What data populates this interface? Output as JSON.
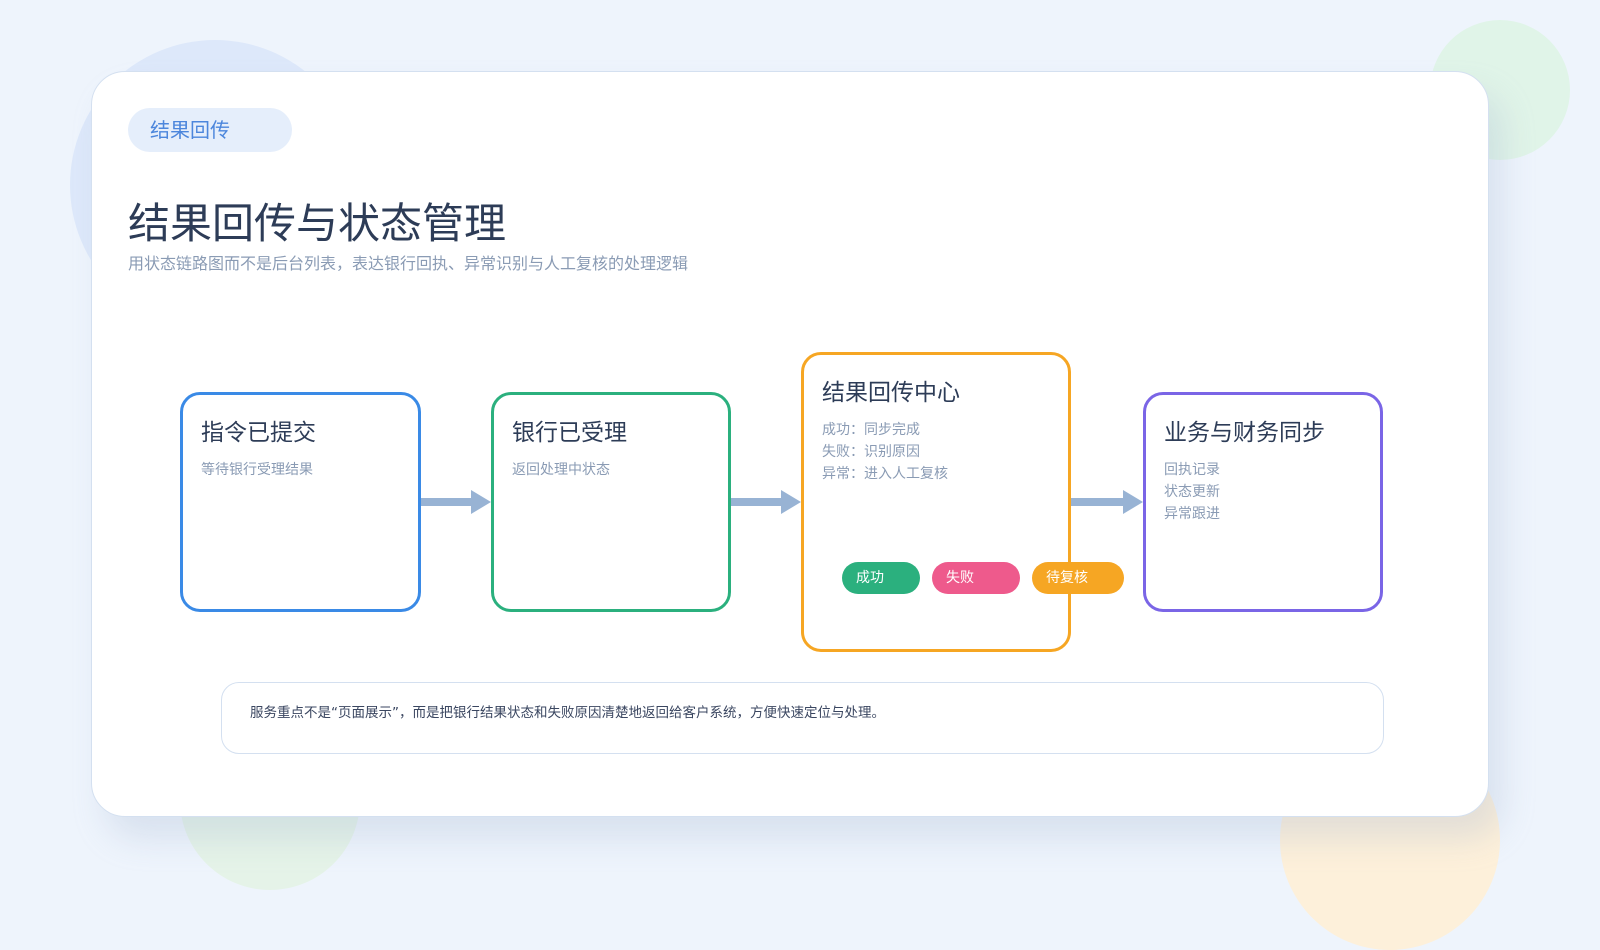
{
  "tag": "结果回传",
  "title": "结果回传与状态管理",
  "subtitle": "用状态链路图而不是后台列表，表达银行回执、异常识别与人工复核的处理逻辑",
  "nodes": [
    {
      "title": "指令已提交",
      "lines": [
        "等待银行受理结果"
      ],
      "color": "#3a8ae6"
    },
    {
      "title": "银行已受理",
      "lines": [
        "返回处理中状态"
      ],
      "color": "#2bb07e"
    },
    {
      "title": "结果回传中心",
      "lines": [
        "成功：同步完成",
        "失败：识别原因",
        "异常：进入人工复核"
      ],
      "color": "#f6a623"
    },
    {
      "title": "业务与财务同步",
      "lines": [
        "回执记录",
        "状态更新",
        "异常跟进"
      ],
      "color": "#7a65e6"
    }
  ],
  "status_chips": [
    {
      "label": "成功",
      "color": "#2bb07e"
    },
    {
      "label": "失败",
      "color": "#ee5a8c"
    },
    {
      "label": "待复核",
      "color": "#f6a623"
    }
  ],
  "note": "服务重点不是“页面展示”，而是把银行结果状态和失败原因清楚地返回给客户系统，方便快速定位与处理。"
}
